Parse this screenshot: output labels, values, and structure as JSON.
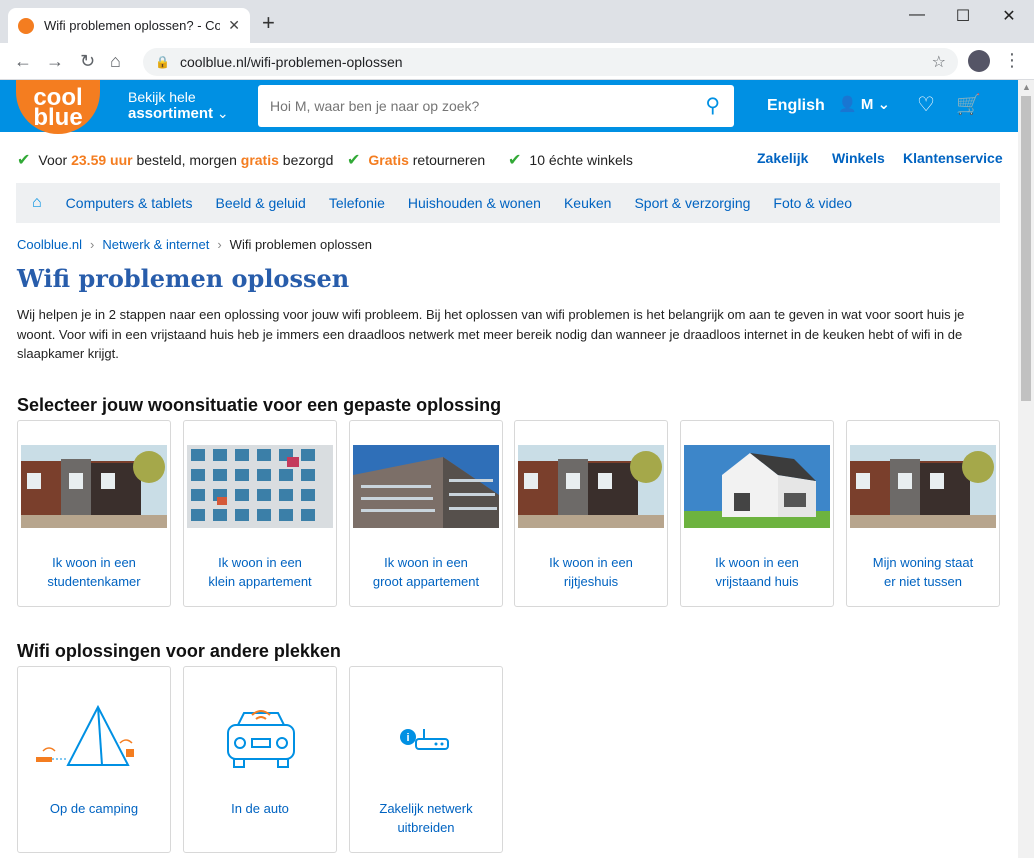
{
  "browser": {
    "tab_title": "Wifi problemen oplossen? - Coolblue",
    "url": "coolblue.nl/wifi-problemen-oplossen"
  },
  "header": {
    "logo_top": "cool",
    "logo_bottom": "blue",
    "assort_line1": "Bekijk hele",
    "assort_line2": "assortiment",
    "search_placeholder": "Hoi M, waar ben je naar op zoek?",
    "language": "English",
    "account_initial": "M"
  },
  "usps": [
    {
      "pre": "Voor ",
      "highlight": "23.59 uur",
      "mid": " besteld, morgen ",
      "highlight2": "gratis",
      "post": " bezorgd"
    },
    {
      "highlight": "Gratis",
      "post": " retourneren"
    },
    {
      "post": "10 échte winkels"
    }
  ],
  "top_links": [
    "Zakelijk",
    "Winkels",
    "Klantenservice"
  ],
  "categories": [
    "Computers & tablets",
    "Beeld & geluid",
    "Telefonie",
    "Huishouden & wonen",
    "Keuken",
    "Sport & verzorging",
    "Foto & video"
  ],
  "breadcrumb": [
    "Coolblue.nl",
    "Netwerk & internet",
    "Wifi problemen oplossen"
  ],
  "title": "Wifi problemen oplossen",
  "intro": "Wij helpen je in 2 stappen naar een oplossing voor jouw wifi probleem. Bij het oplossen van wifi problemen is het belangrijk om aan te geven in wat voor soort huis je woont. Voor wifi in een vrijstaand huis heb je immers een draadloos netwerk met meer bereik nodig dan wanneer je draadloos internet in de keuken hebt of wifi in de slaapkamer krijgt.",
  "section1": {
    "heading": "Selecteer jouw woonsituatie voor een gepaste oplossing",
    "cards": [
      {
        "line1": "Ik woon in een",
        "line2": "studentenkamer"
      },
      {
        "line1": "Ik woon in een",
        "line2": "klein appartement"
      },
      {
        "line1": "Ik woon in een",
        "line2": "groot appartement"
      },
      {
        "line1": "Ik woon in een",
        "line2": "rijtjeshuis"
      },
      {
        "line1": "Ik woon in een",
        "line2": "vrijstaand huis"
      },
      {
        "line1": "Mijn woning staat",
        "line2": "er niet tussen"
      }
    ]
  },
  "section2": {
    "heading": "Wifi oplossingen voor andere plekken",
    "cards": [
      {
        "line1": "Op de camping",
        "line2": ""
      },
      {
        "line1": "In de auto",
        "line2": ""
      },
      {
        "line1": "Zakelijk netwerk",
        "line2": "uitbreiden"
      }
    ]
  },
  "colors": {
    "brand_blue": "#0090e3",
    "brand_orange": "#f47d20",
    "link": "#0063c1",
    "check": "#31a936"
  }
}
